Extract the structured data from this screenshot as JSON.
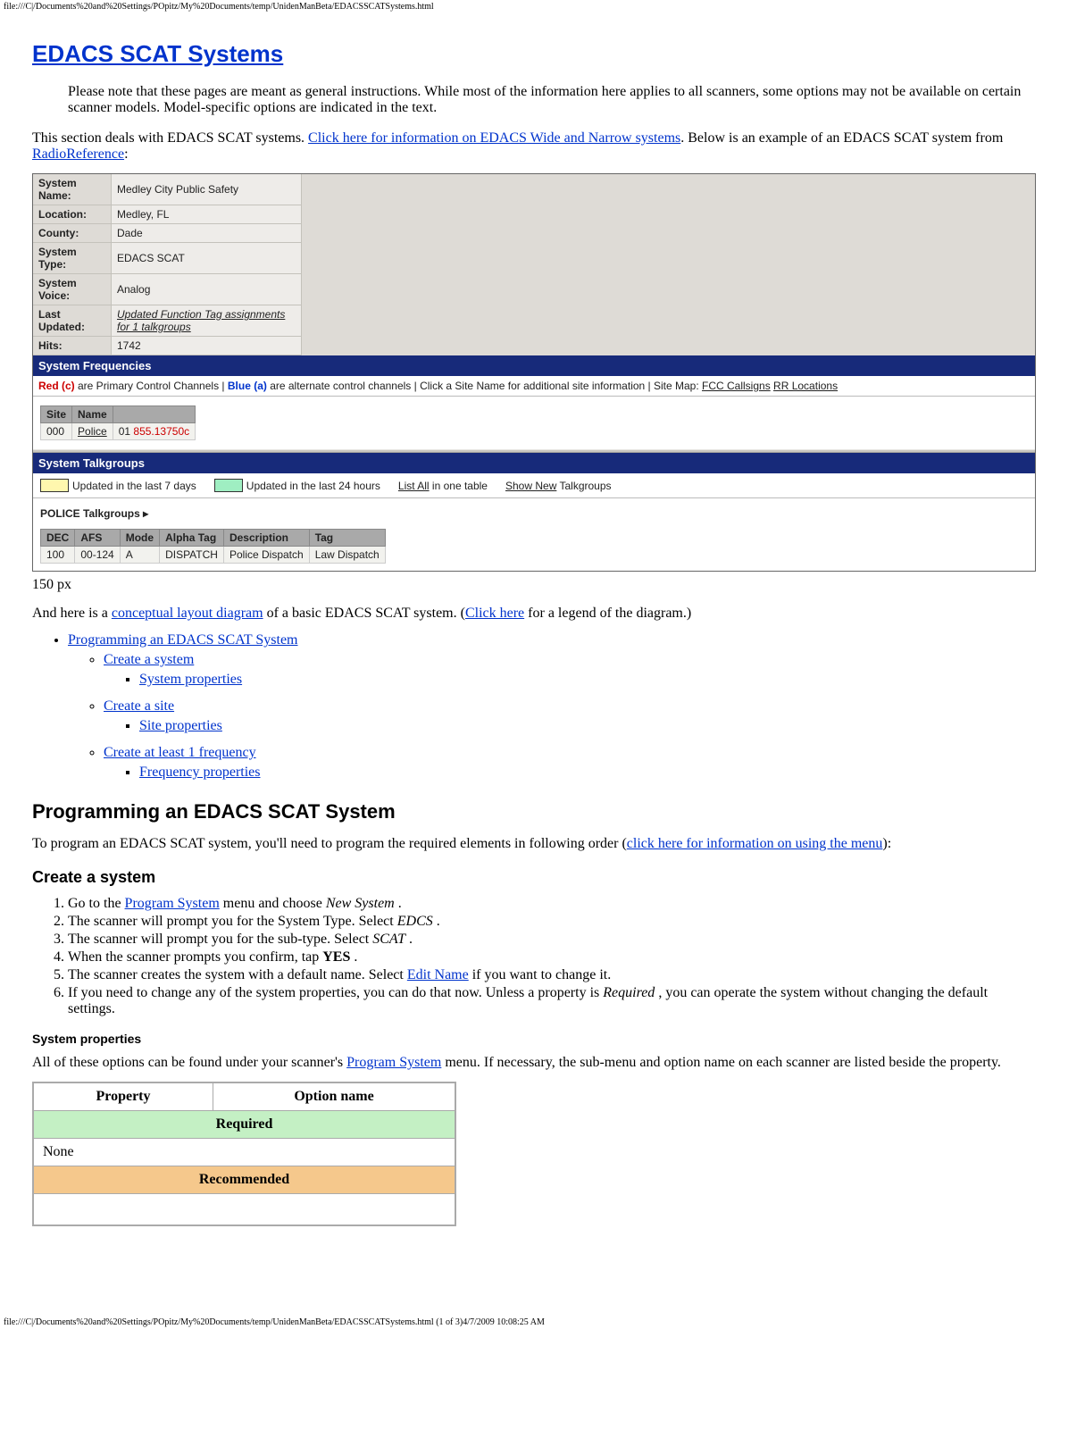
{
  "path_top": "file:///C|/Documents%20and%20Settings/POpitz/My%20Documents/temp/UnidenManBeta/EDACSSCATSystems.html",
  "path_bottom": "file:///C|/Documents%20and%20Settings/POpitz/My%20Documents/temp/UnidenManBeta/EDACSSCATSystems.html (1 of 3)4/7/2009 10:08:25 AM",
  "title": "EDACS SCAT Systems",
  "note": "Please note that these pages are meant as general instructions. While most of the information here applies to all scanners, some options may not be available on certain scanner models. Model-specific options are indicated in the text.",
  "intro_pre": "This section deals with EDACS SCAT systems. ",
  "intro_link1": "Click here for information on EDACS Wide and Narrow systems",
  "intro_mid": ". Below is an example of an EDACS SCAT system from ",
  "intro_link2": "RadioReference",
  "intro_post": ":",
  "sys": {
    "labels": {
      "name": "System Name:",
      "location": "Location:",
      "county": "County:",
      "type": "System Type:",
      "voice": "System Voice:",
      "updated": "Last Updated:",
      "hits": "Hits:"
    },
    "values": {
      "name": "Medley City Public Safety",
      "location": "Medley, FL",
      "county": "Dade",
      "type": "EDACS SCAT",
      "voice": "Analog",
      "updated": "Updated Function Tag assignments for 1 talkgroups",
      "hits": "1742"
    }
  },
  "freq_header": "System Frequencies",
  "legend_red_pre": "Red (c)",
  "legend_red_post": " are Primary Control Channels | ",
  "legend_blue_pre": "Blue (a)",
  "legend_blue_post": " are alternate control channels | Click a Site Name for additional site information | Site Map: ",
  "legend_link1": "FCC Callsigns",
  "legend_link2": "RR Locations",
  "site_headers": {
    "site": "Site",
    "name": "Name",
    "blank": ""
  },
  "site_row": {
    "id": "000",
    "name": "Police",
    "ch": "01",
    "freq": "855.13750c"
  },
  "tg_header": "System Talkgroups",
  "tg_legend": {
    "seven": "Updated in the last 7 days",
    "day": "Updated in the last 24 hours",
    "listall": "List All",
    "listall_post": " in one table",
    "shownew": "Show New",
    "shownew_post": " Talkgroups"
  },
  "tg_group_name": "POLICE Talkgroups  ▸",
  "tg_cols": {
    "dec": "DEC",
    "afs": "AFS",
    "mode": "Mode",
    "alpha": "Alpha Tag",
    "desc": "Description",
    "tag": "Tag"
  },
  "tg_row": {
    "dec": "100",
    "afs": "00-124",
    "mode": "A",
    "alpha": "DISPATCH",
    "desc": "Police Dispatch",
    "tag": "Law Dispatch"
  },
  "caption": "150 px",
  "diagram_pre": "And here is a ",
  "diagram_link": "conceptual layout diagram",
  "diagram_mid": " of a basic EDACS SCAT system. (",
  "diagram_link2": "Click here",
  "diagram_post": " for a legend of the diagram.)",
  "toc": {
    "l1": "Programming an EDACS SCAT System",
    "l2a": "Create a system",
    "l3a": "System properties",
    "l2b": "Create a site",
    "l3b": "Site properties",
    "l2c": "Create at least 1 frequency",
    "l3c": "Frequency properties"
  },
  "h2_program": "Programming an EDACS SCAT System",
  "program_para_pre": "To program an EDACS SCAT system, you'll need to program the required elements in following order (",
  "program_para_link": "click here for information on using the menu",
  "program_para_post": "):",
  "h3_create_system": "Create a system",
  "steps": {
    "s1_pre": "Go to the ",
    "s1_link": "Program System",
    "s1_post": " menu and choose ",
    "s1_em": "New System",
    "s1_end": " .",
    "s2_pre": "The scanner will prompt you for the System Type. Select ",
    "s2_em": "EDCS",
    "s2_end": " .",
    "s3_pre": "The scanner will prompt you for the sub-type. Select ",
    "s3_em": "SCAT",
    "s3_end": " .",
    "s4_pre": "When the scanner prompts you confirm, tap ",
    "s4_b": "YES",
    "s4_end": " .",
    "s5_pre": "The scanner creates the system with a default name. Select ",
    "s5_link": "Edit Name",
    "s5_post": " if you want to change it.",
    "s6_pre": "If you need to change any of the system properties, you can do that now. Unless a property is ",
    "s6_em": "Required",
    "s6_post": " , you can operate the system without changing the default settings."
  },
  "h4_sysprops": "System properties",
  "sysprops_para_pre": "All of these options can be found under your scanner's ",
  "sysprops_para_link": "Program System",
  "sysprops_para_post": " menu. If necessary, the sub-menu and option name on each scanner are listed beside the property.",
  "prop_tbl": {
    "h1": "Property",
    "h2": "Option name",
    "required": "Required",
    "none": "None",
    "recommended": "Recommended"
  }
}
